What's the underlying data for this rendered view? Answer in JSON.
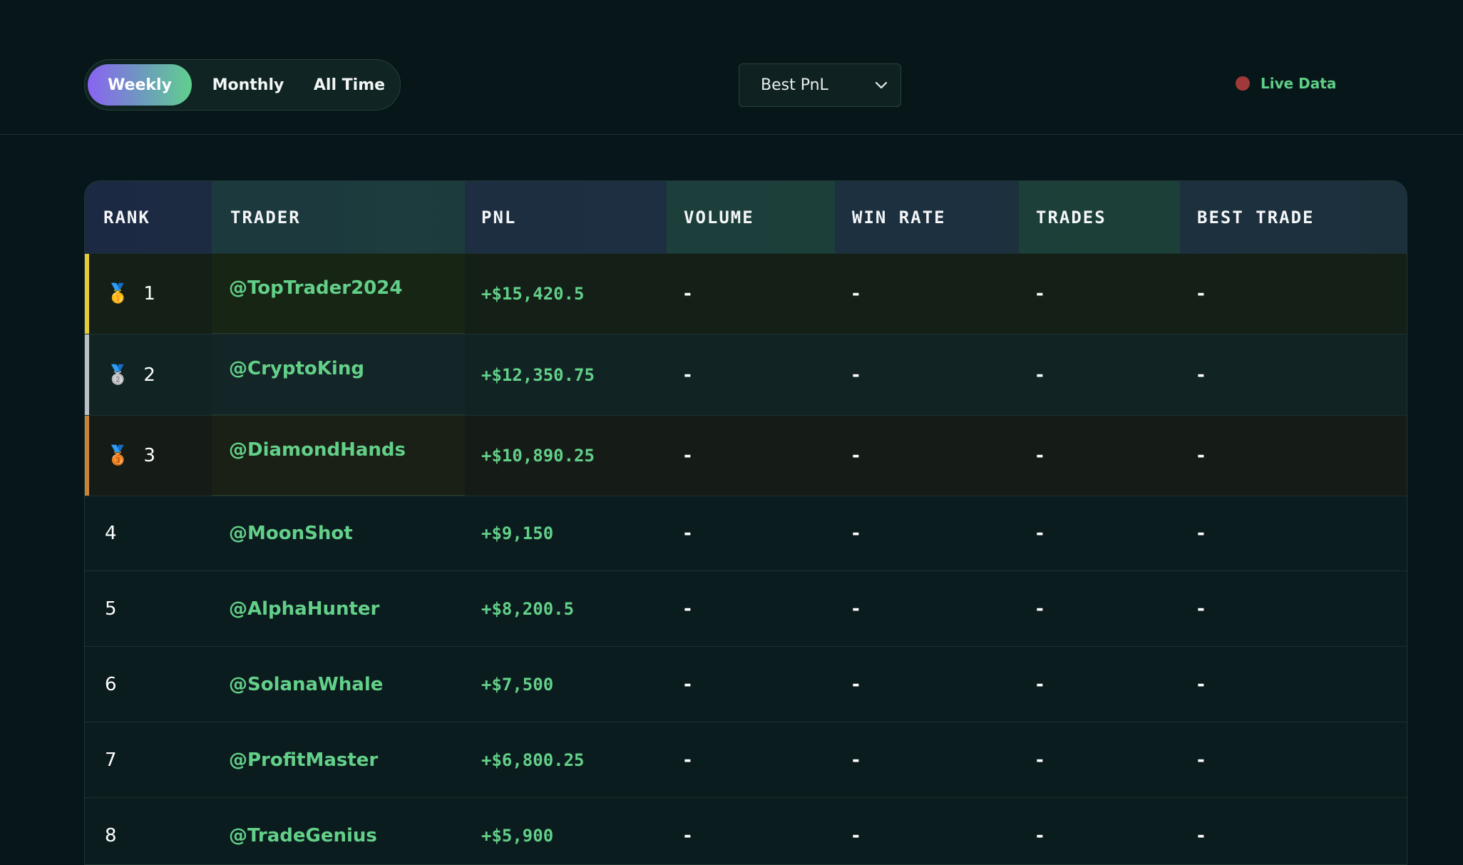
{
  "filters": {
    "periods": [
      "Weekly",
      "Monthly",
      "All Time"
    ],
    "active_period": "Weekly",
    "sort_select": "Best PnL",
    "live_label": "Live Data",
    "live_color": "#a03a3a"
  },
  "table": {
    "columns": [
      "RANK",
      "TRADER",
      "PNL",
      "VOLUME",
      "WIN RATE",
      "TRADES",
      "BEST TRADE"
    ],
    "rows": [
      {
        "rank": "1",
        "medal": "🥇",
        "trader": "@TopTrader2024",
        "pnl": "+$15,420.5",
        "volume": "-",
        "win_rate": "-",
        "trades": "-",
        "best_trade": "-"
      },
      {
        "rank": "2",
        "medal": "🥈",
        "trader": "@CryptoKing",
        "pnl": "+$12,350.75",
        "volume": "-",
        "win_rate": "-",
        "trades": "-",
        "best_trade": "-"
      },
      {
        "rank": "3",
        "medal": "🥉",
        "trader": "@DiamondHands",
        "pnl": "+$10,890.25",
        "volume": "-",
        "win_rate": "-",
        "trades": "-",
        "best_trade": "-"
      },
      {
        "rank": "4",
        "medal": "",
        "trader": "@MoonShot",
        "pnl": "+$9,150",
        "volume": "-",
        "win_rate": "-",
        "trades": "-",
        "best_trade": "-"
      },
      {
        "rank": "5",
        "medal": "",
        "trader": "@AlphaHunter",
        "pnl": "+$8,200.5",
        "volume": "-",
        "win_rate": "-",
        "trades": "-",
        "best_trade": "-"
      },
      {
        "rank": "6",
        "medal": "",
        "trader": "@SolanaWhale",
        "pnl": "+$7,500",
        "volume": "-",
        "win_rate": "-",
        "trades": "-",
        "best_trade": "-"
      },
      {
        "rank": "7",
        "medal": "",
        "trader": "@ProfitMaster",
        "pnl": "+$6,800.25",
        "volume": "-",
        "win_rate": "-",
        "trades": "-",
        "best_trade": "-"
      },
      {
        "rank": "8",
        "medal": "",
        "trader": "@TradeGenius",
        "pnl": "+$5,900",
        "volume": "-",
        "win_rate": "-",
        "trades": "-",
        "best_trade": "-"
      }
    ],
    "top3_bar_colors": [
      "#e8c93a",
      "#b9bfc4",
      "#c9823a"
    ],
    "pnl_color": "#63d089"
  }
}
